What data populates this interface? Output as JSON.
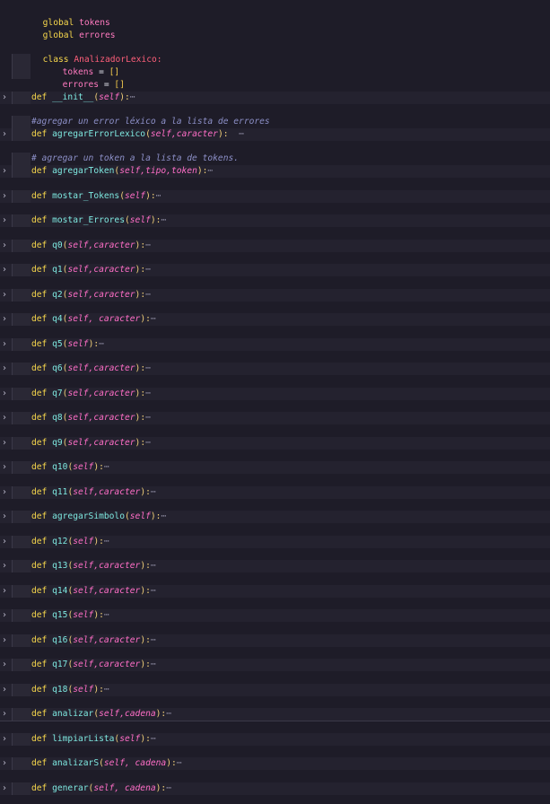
{
  "editor": {
    "header_lines": [
      {
        "keyword": "global",
        "name": "tokens"
      },
      {
        "keyword": "global",
        "name": "errores"
      }
    ],
    "class_keyword": "class",
    "class_name": "AnalizadorLexico:",
    "attributes": [
      {
        "name": "tokens",
        "op": " = ",
        "value": "[]"
      },
      {
        "name": "errores",
        "op": " = ",
        "value": "[]"
      }
    ],
    "def_keyword": "def",
    "fold_icon": "chevron-right-icon",
    "ellipsis": "⋯",
    "comments": [
      "#agregar un error léxico a la lista de errores",
      "# agregar un token a la lista de tokens."
    ],
    "methods": [
      {
        "name": "__init__",
        "params": "self"
      },
      {
        "name": "agregarErrorLexico",
        "params": "self,caracter",
        "trail": "  "
      },
      {
        "name": "agregarToken",
        "params": "self,tipo,token"
      },
      {
        "name": "mostar_Tokens",
        "params": "self"
      },
      {
        "name": "mostar_Errores",
        "params": "self"
      },
      {
        "name": "q0",
        "params": "self,caracter"
      },
      {
        "name": "q1",
        "params": "self,caracter"
      },
      {
        "name": "q2",
        "params": "self,caracter"
      },
      {
        "name": "q4",
        "params": "self, caracter"
      },
      {
        "name": "q5",
        "params": "self"
      },
      {
        "name": "q6",
        "params": "self,caracter"
      },
      {
        "name": "q7",
        "params": "self,caracter"
      },
      {
        "name": "q8",
        "params": "self,caracter"
      },
      {
        "name": "q9",
        "params": "self,caracter"
      },
      {
        "name": "q10",
        "params": "self"
      },
      {
        "name": "q11",
        "params": "self,caracter"
      },
      {
        "name": "agregarSimbolo",
        "params": "self"
      },
      {
        "name": "q12",
        "params": "self"
      },
      {
        "name": "q13",
        "params": "self,caracter"
      },
      {
        "name": "q14",
        "params": "self,caracter"
      },
      {
        "name": "q15",
        "params": "self"
      },
      {
        "name": "q16",
        "params": "self,caracter"
      },
      {
        "name": "q17",
        "params": "self,caracter"
      },
      {
        "name": "q18",
        "params": "self"
      },
      {
        "name": "analizar",
        "params": "self,cadena"
      },
      {
        "name": "limpiarLista",
        "params": "self"
      },
      {
        "name": "analizarS",
        "params": "self, cadena"
      },
      {
        "name": "generar",
        "params": "self, cadena"
      }
    ]
  }
}
